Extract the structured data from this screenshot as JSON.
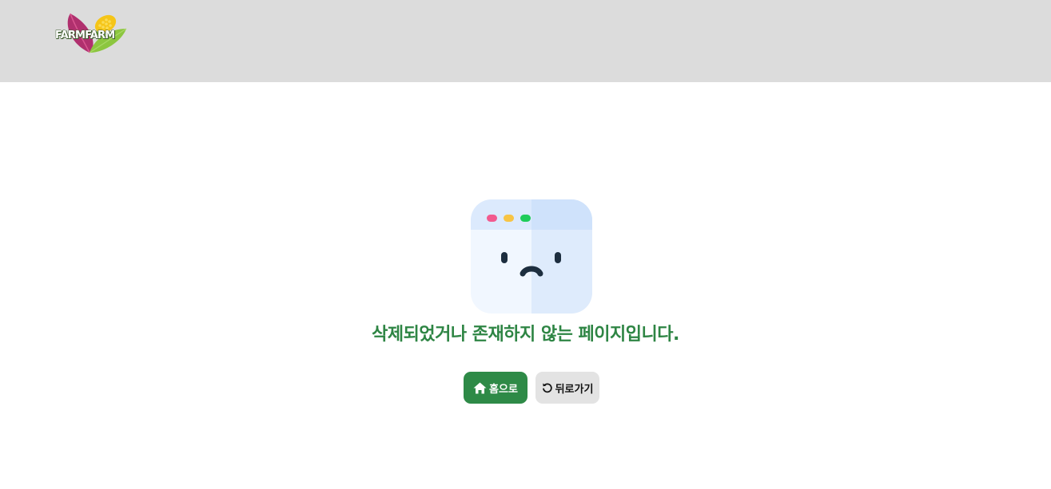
{
  "header": {
    "logo_text": "FARMFARM"
  },
  "main": {
    "message": "삭제되었거나 존재하지 않는 페이지입니다.",
    "buttons": {
      "home_label": "홈으로",
      "back_label": "뒤로가기"
    }
  },
  "icons": {
    "home": "home-icon",
    "back": "undo-icon",
    "illustration": "sad-browser-window-icon"
  },
  "colors": {
    "header_bg": "#dcdcdc",
    "accent_green": "#2e8a47",
    "message_green": "#2e8544",
    "back_button_bg": "#e3e3e3",
    "dot_pink": "#f25a8f",
    "dot_yellow": "#f7c444",
    "dot_green": "#1fcc5a"
  }
}
